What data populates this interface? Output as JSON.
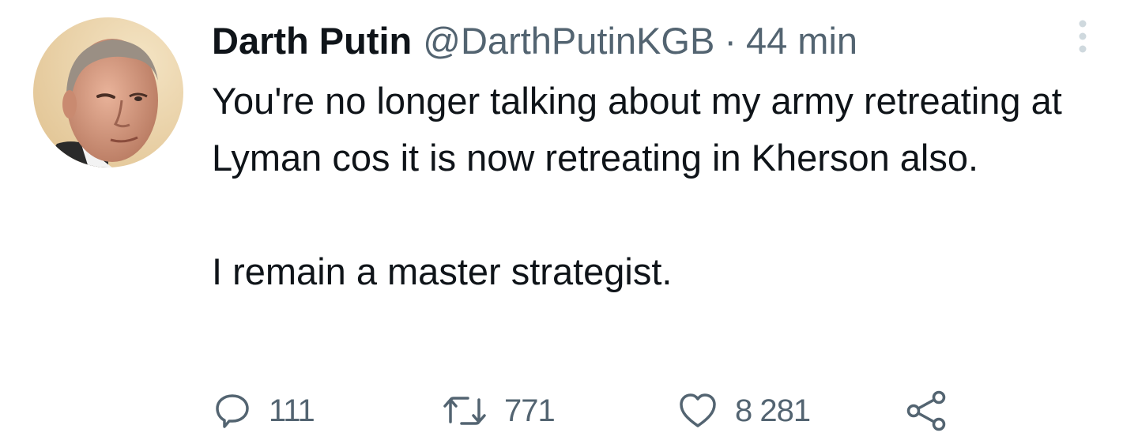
{
  "tweet": {
    "display_name": "Darth Putin",
    "handle": "@DarthPutinKGB",
    "separator": "·",
    "time": "44 min",
    "body_paragraph_1": "You're no longer talking about my army retreating at Lyman cos it is now retreating in Kherson also.",
    "body_paragraph_2": "I remain a master strategist.",
    "icons": {
      "avatar": "profile-photo",
      "more": "more-vertical-icon",
      "reply": "reply-bubble-icon",
      "retweet": "retweet-icon",
      "like": "heart-icon",
      "share": "share-icon"
    },
    "counts": {
      "replies": "111",
      "retweets": "771",
      "likes": "8 281"
    },
    "colors": {
      "text": "#0f1419",
      "secondary": "#536471"
    }
  }
}
